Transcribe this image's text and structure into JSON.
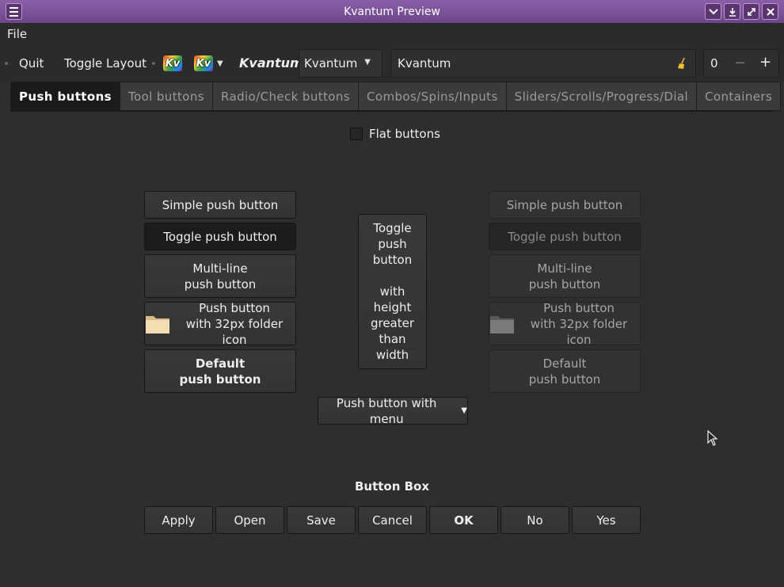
{
  "window": {
    "title": "Kvantum Preview"
  },
  "menubar": {
    "file": "File"
  },
  "toolbar": {
    "quit": "Quit",
    "toggle_layout": "Toggle Layout",
    "kv_logo_text": "Kv",
    "kvantum_label": "Kvantum",
    "combo_value": "Kvantum",
    "lineedit_value": "Kvantum",
    "spin_value": "0",
    "spin_minus": "−",
    "spin_plus": "+"
  },
  "tabs": [
    {
      "label": "Push buttons",
      "active": true
    },
    {
      "label": "Tool buttons"
    },
    {
      "label": "Radio/Check buttons"
    },
    {
      "label": "Combos/Spins/Inputs"
    },
    {
      "label": "Sliders/Scrolls/Progress/Dial"
    },
    {
      "label": "Containers"
    }
  ],
  "push_buttons": {
    "flat_buttons": "Flat buttons",
    "left": {
      "simple": "Simple push button",
      "toggle": "Toggle push button",
      "multiline_1": "Multi-line",
      "multiline_2": "push button",
      "icon_1": "Push button",
      "icon_2": "with 32px folder icon",
      "default_1": "Default",
      "default_2": "push button"
    },
    "center_toggle": [
      "Toggle",
      "push",
      "button",
      "",
      "with",
      "height",
      "greater",
      "than",
      "width"
    ],
    "right": {
      "simple": "Simple push button",
      "toggle": "Toggle push button",
      "multiline_1": "Multi-line",
      "multiline_2": "push button",
      "icon_1": "Push button",
      "icon_2": "with 32px folder icon",
      "default_1": "Default",
      "default_2": "push button"
    },
    "menu_button": "Push button with menu"
  },
  "button_box": {
    "label": "Button Box",
    "buttons": [
      "Apply",
      "Open",
      "Save",
      "Cancel",
      "OK",
      "No",
      "Yes"
    ]
  },
  "colors": {
    "titlebar": "#7a4f97",
    "background": "#2e2e2e",
    "active_tab": "#1b1b1b"
  }
}
